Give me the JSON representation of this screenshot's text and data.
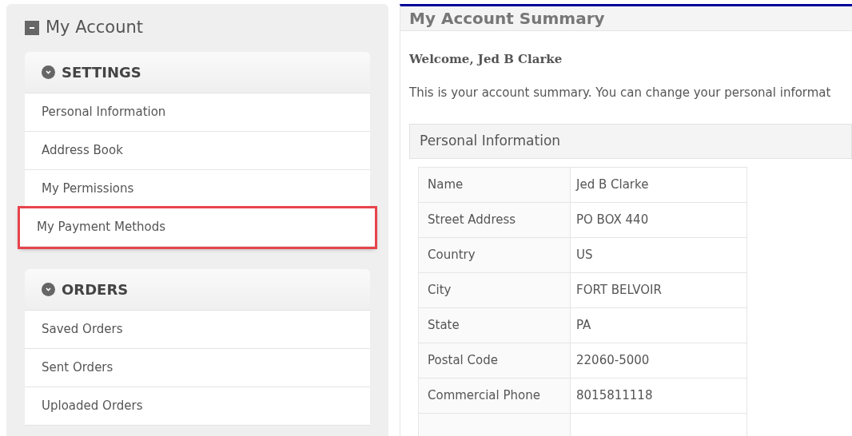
{
  "sidebar": {
    "title": "My Account",
    "collapsed": false,
    "sections": [
      {
        "title": "SETTINGS",
        "expanded": true,
        "items": [
          {
            "label": "Personal Information",
            "highlighted": false
          },
          {
            "label": "Address Book",
            "highlighted": false
          },
          {
            "label": "My Permissions",
            "highlighted": false
          },
          {
            "label": "My Payment Methods",
            "highlighted": true
          }
        ]
      },
      {
        "title": "ORDERS",
        "expanded": true,
        "items": [
          {
            "label": "Saved Orders",
            "highlighted": false
          },
          {
            "label": "Sent Orders",
            "highlighted": false
          },
          {
            "label": "Uploaded Orders",
            "highlighted": false
          }
        ]
      }
    ]
  },
  "main": {
    "title": "My Account Summary",
    "welcome": "Welcome, Jed B Clarke",
    "intro": "This is your account summary. You can change your personal informat",
    "section_title": "Personal Information",
    "rows": [
      {
        "label": "Name",
        "value": "Jed B Clarke"
      },
      {
        "label": "Street Address",
        "value": "PO BOX 440"
      },
      {
        "label": "Country",
        "value": "US"
      },
      {
        "label": "City",
        "value": "FORT BELVOIR"
      },
      {
        "label": "State",
        "value": "PA"
      },
      {
        "label": "Postal Code",
        "value": "22060-5000"
      },
      {
        "label": "Commercial Phone",
        "value": "8015811118"
      }
    ]
  }
}
